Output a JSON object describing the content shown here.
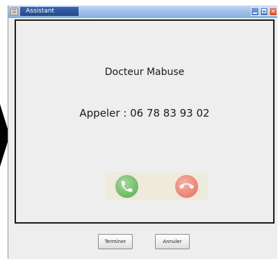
{
  "window": {
    "title": "Assistant"
  },
  "contact": {
    "name": "Docteur Mabuse",
    "call_line": "Appeler : 06 78 83 93 02"
  },
  "call_controls": {
    "accept_icon": "phone-accept-icon",
    "hangup_icon": "phone-hangup-icon",
    "accept_color": "#78c070",
    "hangup_color": "#ee8a7c"
  },
  "footer": {
    "finish_label": "Terminer",
    "cancel_label": "Annuler"
  },
  "colors": {
    "titlebar": "#9ebde8",
    "close_button": "#d54a2a",
    "window_background": "#eeeeee",
    "panel_border": "#1a1a1a"
  }
}
